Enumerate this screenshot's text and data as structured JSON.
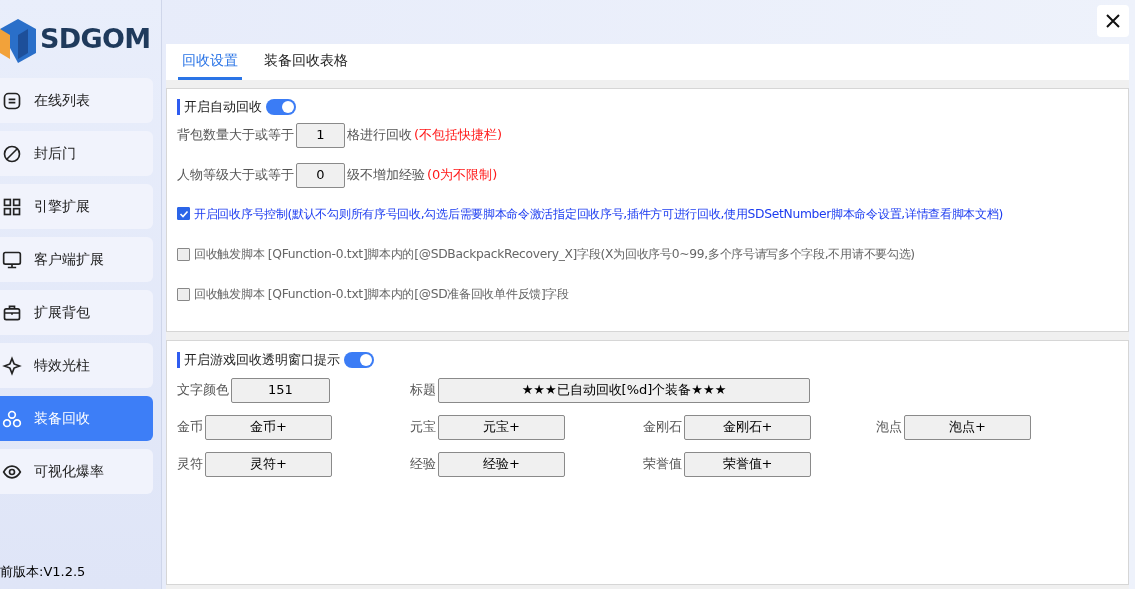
{
  "brand": {
    "name": "SDGOM"
  },
  "sidebar": {
    "items": [
      {
        "label": "在线列表",
        "selected": false
      },
      {
        "label": "封后门",
        "selected": false
      },
      {
        "label": "引擎扩展",
        "selected": false
      },
      {
        "label": "客户端扩展",
        "selected": false
      },
      {
        "label": "扩展背包",
        "selected": false
      },
      {
        "label": "特效光柱",
        "selected": false
      },
      {
        "label": "装备回收",
        "selected": true
      },
      {
        "label": "可视化爆率",
        "selected": false
      }
    ],
    "version": "前版本:V1.2.5"
  },
  "tabs": [
    {
      "label": "回收设置",
      "selected": true
    },
    {
      "label": "装备回收表格",
      "selected": false
    }
  ],
  "auto_recycle": {
    "title": "开启自动回收",
    "on": true,
    "inputs": [
      {
        "before": "背包数量大于或等于",
        "value": "1",
        "after": "格进行回收",
        "note": "(不包括快捷栏)"
      },
      {
        "before": "人物等级大于或等于",
        "value": "0",
        "after": "级不增加经验",
        "note": "(0为不限制)"
      }
    ],
    "checks": [
      {
        "label": "开启回收序号控制(默认不勾则所有序号回收,勾选后需要脚本命令激活指定回收序号,插件方可进行回收,使用SDSetNumber脚本命令设置,详情查看脚本文档)",
        "checked": true
      },
      {
        "label": "回收触发脚本 [QFunction-0.txt]脚本内的[@SDBackpackRecovery_X]字段(X为回收序号0~99,多个序号请写多个字段,不用请不要勾选)",
        "checked": false
      },
      {
        "label": "回收触发脚本 [QFunction-0.txt]脚本内的[@SD准备回收单件反馈]字段",
        "checked": false
      }
    ]
  },
  "tip_window": {
    "title": "开启游戏回收透明窗口提示",
    "on": true,
    "color": {
      "label": "文字颜色",
      "value": "151"
    },
    "heading": {
      "label": "标题",
      "value": "★★★已自动回收[%d]个装备★★★"
    },
    "rows": [
      [
        {
          "label": "金币",
          "value": "金币+"
        },
        {
          "label": "元宝",
          "value": "元宝+"
        },
        {
          "label": "金刚石",
          "value": "金刚石+"
        },
        {
          "label": "泡点",
          "value": "泡点+"
        }
      ],
      [
        {
          "label": "灵符",
          "value": "灵符+"
        },
        {
          "label": "经验",
          "value": "经验+"
        },
        {
          "label": "荣誉值",
          "value": "荣誉值+"
        }
      ]
    ]
  }
}
